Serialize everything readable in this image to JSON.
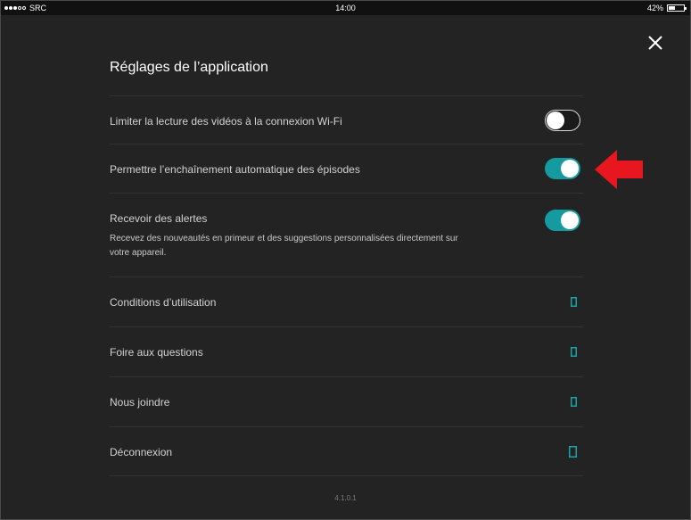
{
  "status_bar": {
    "carrier": "SRC",
    "time": "14:00",
    "battery": "42%",
    "battery_level": 0.42
  },
  "settings": {
    "title": "Réglages de l’application",
    "close_icon": "close-x-icon",
    "toggles": [
      {
        "label": "Limiter la lecture des vidéos à la connexion Wi-Fi",
        "state": "off"
      },
      {
        "label": "Permettre l’enchaînement automatique des épisodes",
        "state": "on"
      },
      {
        "label": "Recevoir des alertes",
        "description": "Recevez des nouveautés en primeur et des suggestions personnalisées directement sur votre appareil.",
        "state": "on"
      }
    ],
    "links": [
      {
        "label": "Conditions d’utilisation",
        "icon": "external-link-icon"
      },
      {
        "label": "Foire aux questions",
        "icon": "external-link-icon"
      },
      {
        "label": "Nous joindre",
        "icon": "external-link-icon"
      },
      {
        "label": "Déconnexion",
        "icon": "logout-icon"
      }
    ],
    "version": "4.1.0.1"
  },
  "colors": {
    "background": "#232323",
    "toggle_on": "#159aa0",
    "link_icon": "#1aa3aa",
    "annotation_arrow": "#e8171f"
  }
}
